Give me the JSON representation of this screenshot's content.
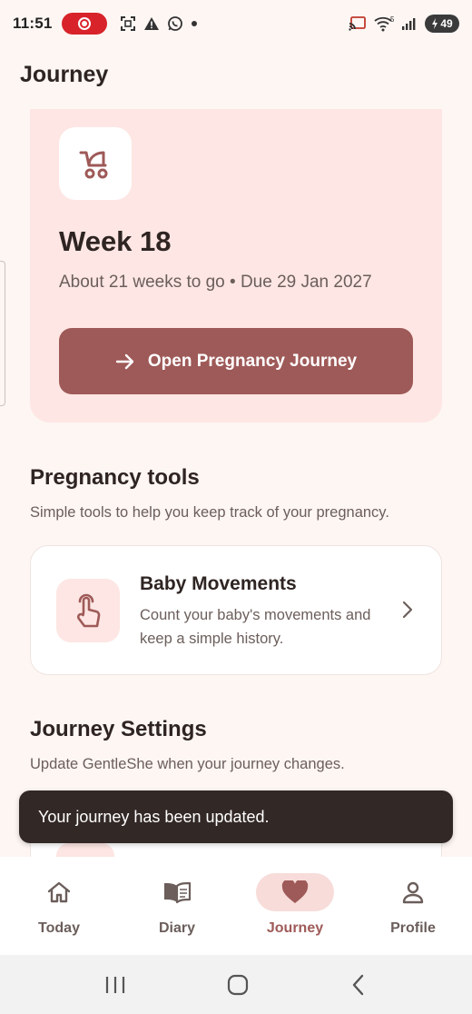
{
  "status_bar": {
    "time": "11:51",
    "battery": "49",
    "network": "5"
  },
  "page": {
    "title": "Journey"
  },
  "hero": {
    "icon": "stroller-icon",
    "week": "Week 18",
    "subtitle": "About 21 weeks to go • Due 29 Jan 2027",
    "button_label": "Open Pregnancy Journey"
  },
  "tools": {
    "title": "Pregnancy tools",
    "subtitle": "Simple tools to help you keep track of your pregnancy.",
    "items": [
      {
        "title": "Baby Movements",
        "description": "Count your baby's movements and keep a simple history.",
        "icon": "touch-icon"
      }
    ]
  },
  "settings": {
    "title": "Journey Settings",
    "subtitle": "Update GentleShe when your journey changes."
  },
  "snackbar": {
    "message": "Your journey has been updated."
  },
  "bottom_nav": {
    "items": [
      {
        "label": "Today",
        "icon": "home-icon"
      },
      {
        "label": "Diary",
        "icon": "book-icon"
      },
      {
        "label": "Journey",
        "icon": "heart-icon",
        "active": true
      },
      {
        "label": "Profile",
        "icon": "person-icon"
      }
    ]
  },
  "colors": {
    "accent": "#9e5a58",
    "hero_bg": "#fde6e3",
    "background": "#fdf6f3",
    "snackbar": "#322826"
  }
}
